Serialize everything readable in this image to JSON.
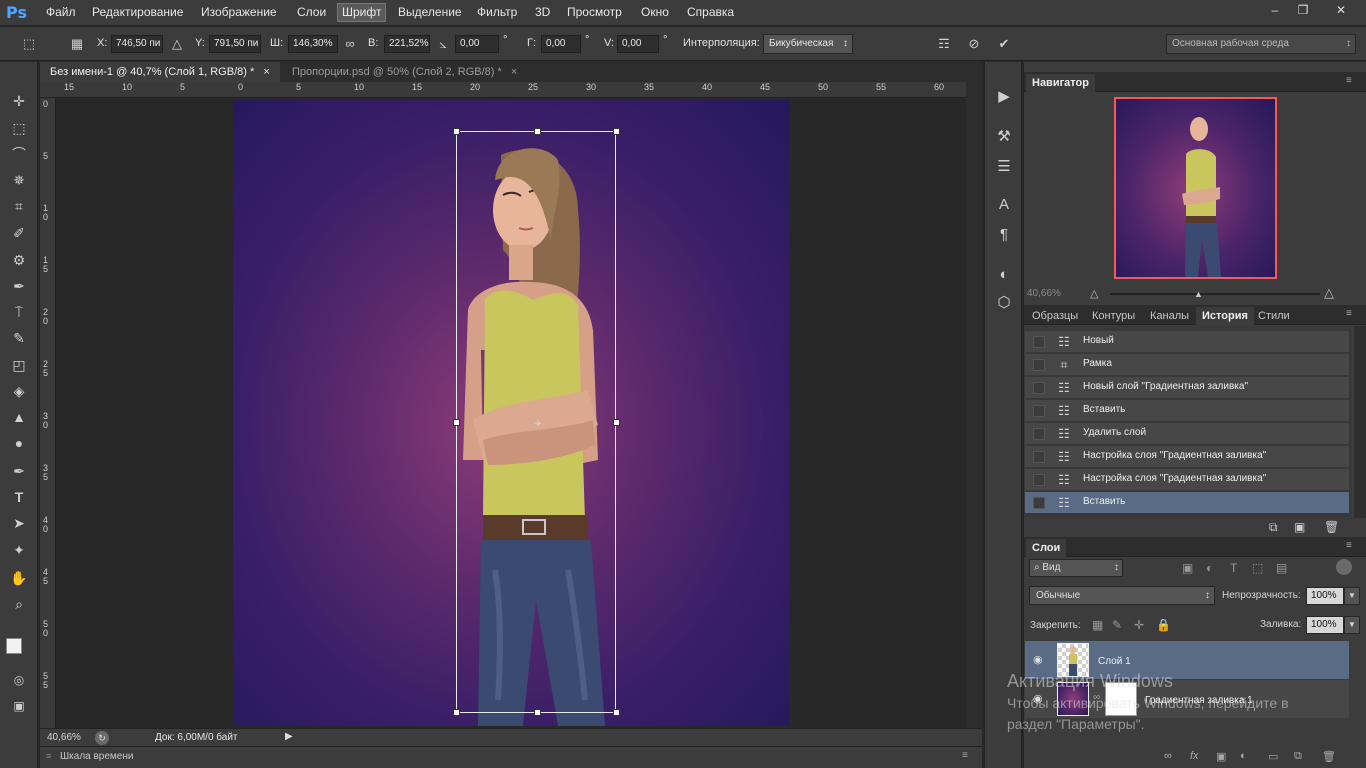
{
  "app": {
    "logo": "Ps"
  },
  "menu": [
    "Файл",
    "Редактирование",
    "Изображение",
    "Слои",
    "Шрифт",
    "Выделение",
    "Фильтр",
    "3D",
    "Просмотр",
    "Окно",
    "Справка"
  ],
  "options": {
    "x_label": "X:",
    "x_value": "746,50 пи",
    "y_label": "Y:",
    "y_value": "791,50 пи",
    "w_label": "Ш:",
    "w_value": "146,30%",
    "h_label": "В:",
    "h_value": "221,52%",
    "angle_value": "0,00",
    "angle_unit": "°",
    "hskew_label": "Г:",
    "hskew_value": "0,00",
    "hskew_unit": "°",
    "vskew_label": "V:",
    "vskew_value": "0,00",
    "vskew_unit": "°",
    "interp_label": "Интерполяция:",
    "interp_value": "Бикубическая",
    "workspace": "Основная рабочая среда"
  },
  "tabs": [
    {
      "label": "Без имени-1 @ 40,7% (Слой 1, RGB/8) *",
      "close": "×"
    },
    {
      "label": "Пропорции.psd @ 50% (Слой 2, RGB/8) *",
      "close": "×"
    }
  ],
  "hruler": [
    "15",
    "10",
    "5",
    "0",
    "5",
    "10",
    "15",
    "20",
    "25",
    "30",
    "35",
    "40",
    "45",
    "50",
    "55",
    "60"
  ],
  "vruler": [
    "0",
    "5",
    "1 0",
    "1 5",
    "2 0",
    "2 5",
    "3 0",
    "3 5",
    "4 0",
    "4 5",
    "5 0",
    "5 5"
  ],
  "status": {
    "zoom": "40,66%",
    "doc": "Док: 6,00M/0 байт"
  },
  "timeline": {
    "label": "Шкала времени"
  },
  "navigator": {
    "title": "Навигатор",
    "zoom": "40,66%"
  },
  "history_tabs": [
    "Образцы",
    "Контуры",
    "Каналы",
    "История",
    "Стили"
  ],
  "history": [
    {
      "label": "Новый",
      "icon": "document-icon",
      "selected": false
    },
    {
      "label": "Рамка",
      "icon": "crop-icon",
      "selected": false
    },
    {
      "label": "Новый слой \"Градиентная заливка\"",
      "icon": "document-icon",
      "selected": false
    },
    {
      "label": "Вставить",
      "icon": "document-icon",
      "selected": false
    },
    {
      "label": "Удалить слой",
      "icon": "document-icon",
      "selected": false
    },
    {
      "label": "Настройка слоя \"Градиентная заливка\"",
      "icon": "document-icon",
      "selected": false
    },
    {
      "label": "Настройка слоя \"Градиентная заливка\"",
      "icon": "document-icon",
      "selected": false
    },
    {
      "label": "Вставить",
      "icon": "document-icon",
      "selected": true
    }
  ],
  "layers_panel": {
    "title": "Слои",
    "filter": "Вид",
    "blend_mode": "Обычные",
    "opacity_label": "Непрозрачность:",
    "opacity_value": "100%",
    "lock_label": "Закрепить:",
    "fill_label": "Заливка:",
    "fill_value": "100%",
    "layers": [
      {
        "name": "Слой 1",
        "selected": true
      },
      {
        "name": "Градиентная заливка 1",
        "selected": false
      }
    ]
  },
  "watermark": {
    "line1": "Активация Windows",
    "line2": "Чтобы активировать Windows, перейдите в",
    "line3": "раздел \"Параметры\"."
  },
  "colors": {
    "accent": "#4da6ff",
    "selection": "#5a6b85",
    "nav_frame": "#ff5555"
  }
}
